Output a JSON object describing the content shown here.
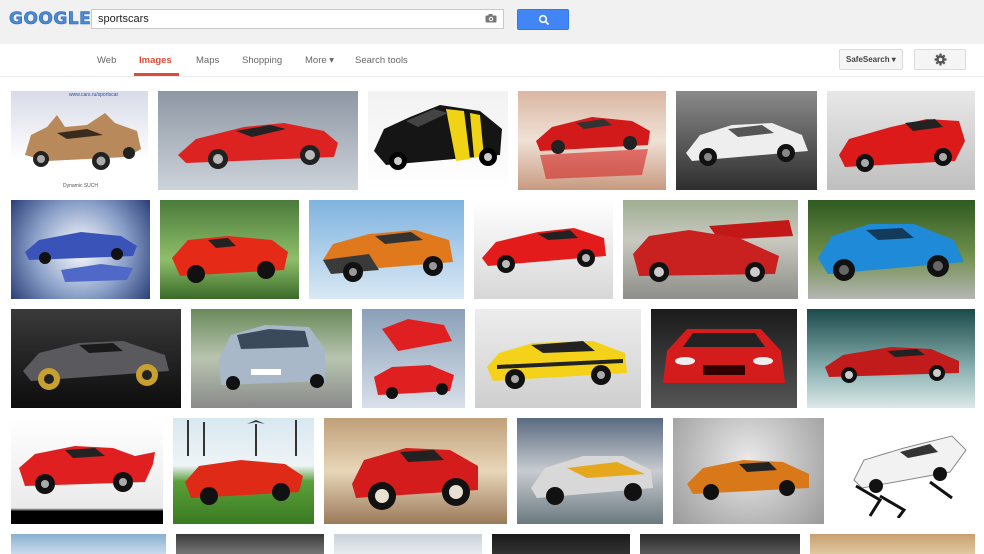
{
  "header": {
    "logo": "GOOGLE",
    "query": "sportscars"
  },
  "nav": {
    "tabs": [
      "Web",
      "Images",
      "Maps",
      "Shopping",
      "More ▾",
      "Search tools"
    ],
    "safesearch_label": "SafeSearch ▾"
  },
  "results": {
    "thumb_texts": {
      "caption_first": "Dynamic SUCH",
      "watermark_first": "www.cars.ru/sportscar"
    }
  },
  "icons": {
    "camera": "camera-icon",
    "search": "magnifier-icon",
    "settings": "gear-icon"
  },
  "colors": {
    "accent": "#dd4b39",
    "search_button": "#4285f4",
    "logo": "#4d8ad6"
  }
}
